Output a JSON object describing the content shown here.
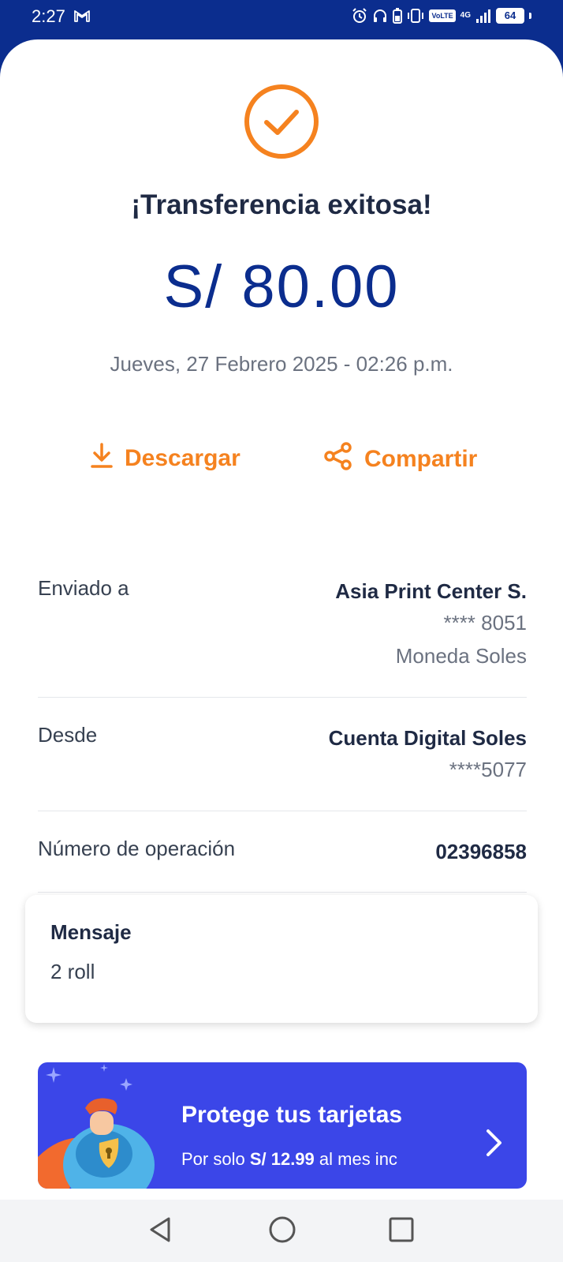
{
  "status_bar": {
    "time": "2:27",
    "volte": "VoLTE",
    "network": "4G",
    "battery": "64"
  },
  "receipt": {
    "title": "¡Transferencia exitosa!",
    "amount": "S/ 80.00",
    "datetime": "Jueves, 27 Febrero 2025 - 02:26 p.m."
  },
  "actions": {
    "download_label": "Descargar",
    "share_label": "Compartir"
  },
  "details": {
    "sent_to": {
      "label": "Enviado a",
      "name": "Asia Print Center S.",
      "account": "**** 8051",
      "currency": "Moneda Soles"
    },
    "from": {
      "label": "Desde",
      "name": "Cuenta Digital Soles",
      "account": "****5077"
    },
    "operation": {
      "label": "Número de operación",
      "number": "02396858"
    }
  },
  "message": {
    "title": "Mensaje",
    "text": "2 roll"
  },
  "promo": {
    "title": "Protege tus tarjetas",
    "sub_prefix": "Por solo ",
    "sub_price": "S/ 12.99",
    "sub_suffix": " al mes inc"
  },
  "colors": {
    "brand_blue": "#0b2d8e",
    "accent_orange": "#f5821f",
    "promo_blue": "#3b46e8"
  }
}
